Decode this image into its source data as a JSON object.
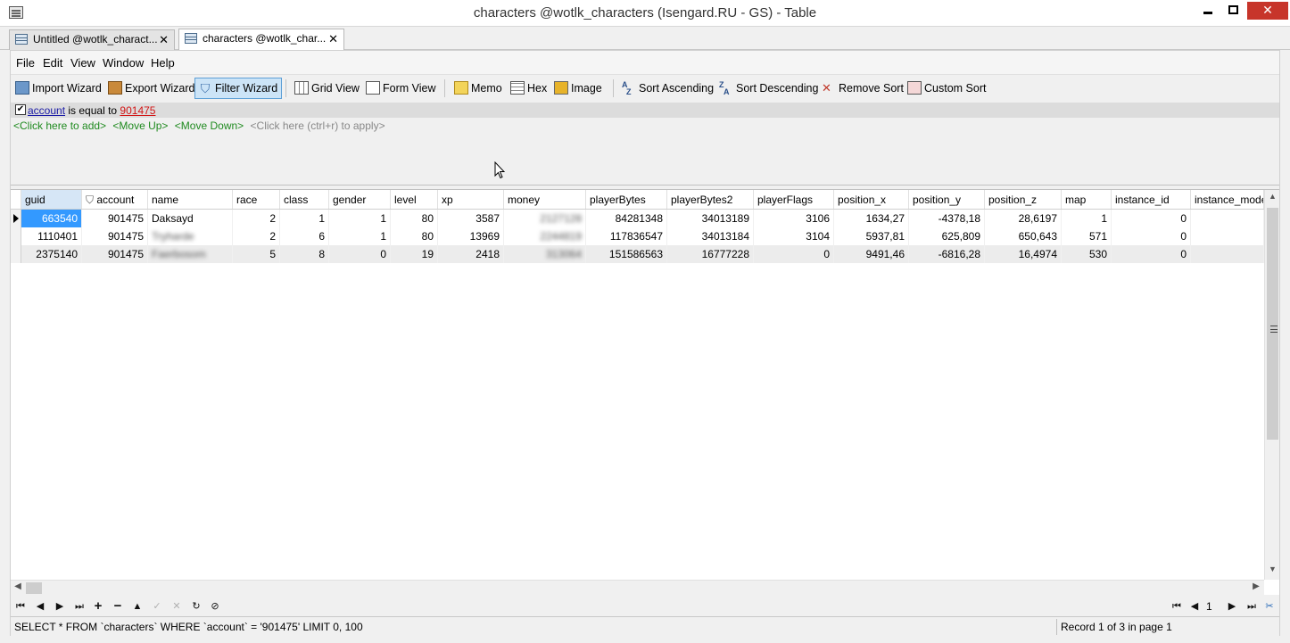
{
  "window": {
    "title": "characters @wotlk_characters (Isengard.RU - GS) - Table"
  },
  "tabs": [
    {
      "label": "Untitled @wotlk_charact...",
      "active": false
    },
    {
      "label": "characters @wotlk_char...",
      "active": true
    }
  ],
  "menu": [
    "File",
    "Edit",
    "View",
    "Window",
    "Help"
  ],
  "toolbar": {
    "import_wizard": "Import Wizard",
    "export_wizard": "Export Wizard",
    "filter_wizard": "Filter Wizard",
    "grid_view": "Grid View",
    "form_view": "Form View",
    "memo": "Memo",
    "hex": "Hex",
    "image": "Image",
    "sort_ascending": "Sort Ascending",
    "sort_descending": "Sort Descending",
    "remove_sort": "Remove Sort",
    "custom_sort": "Custom Sort"
  },
  "filter": {
    "field": "account",
    "operator": "is equal to",
    "value": "901475",
    "add": "<Click here to add>",
    "move_up": "<Move Up>",
    "move_down": "<Move Down>",
    "apply": "<Click here (ctrl+r) to apply>"
  },
  "grid": {
    "columns": [
      "guid",
      "account",
      "name",
      "race",
      "class",
      "gender",
      "level",
      "xp",
      "money",
      "playerBytes",
      "playerBytes2",
      "playerFlags",
      "position_x",
      "position_y",
      "position_z",
      "map",
      "instance_id",
      "instance_mode_m"
    ],
    "rows": [
      [
        "663540",
        "901475",
        "Daksayd",
        "2",
        "1",
        "1",
        "80",
        "3587",
        "2127128",
        "84281348",
        "34013189",
        "3106",
        "1634,27",
        "-4378,18",
        "28,6197",
        "1",
        "0",
        ""
      ],
      [
        "1110401",
        "901475",
        "Tryharde",
        "2",
        "6",
        "1",
        "80",
        "13969",
        "2244819",
        "117836547",
        "34013184",
        "3104",
        "5937,81",
        "625,809",
        "650,643",
        "571",
        "0",
        ""
      ],
      [
        "2375140",
        "901475",
        "Faerbosom",
        "5",
        "8",
        "0",
        "19",
        "2418",
        "313064",
        "151586563",
        "16777228",
        "0",
        "9491,46",
        "-6816,28",
        "16,4974",
        "530",
        "0",
        ""
      ]
    ]
  },
  "navigation": {
    "page": "1"
  },
  "status": {
    "sql": "SELECT * FROM `characters` WHERE `account` = '901475' LIMIT 0, 100",
    "record": "Record 1 of 3 in page 1"
  }
}
